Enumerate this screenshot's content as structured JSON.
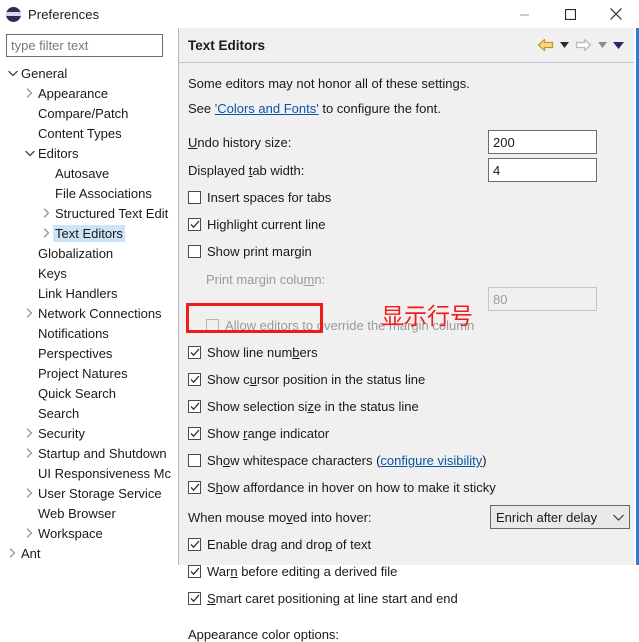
{
  "window": {
    "title": "Preferences",
    "icon": "eclipse-icon",
    "controls": {
      "minimize": "minimize-icon",
      "maximize": "maximize-icon",
      "close": "close-icon"
    }
  },
  "sidebar": {
    "filter": {
      "value": "",
      "placeholder": "type filter text"
    },
    "items": [
      {
        "label": "General",
        "indent": 0,
        "twisty": "expanded",
        "selected": false
      },
      {
        "label": "Appearance",
        "indent": 1,
        "twisty": "collapsed",
        "selected": false
      },
      {
        "label": "Compare/Patch",
        "indent": 1,
        "twisty": "none",
        "selected": false
      },
      {
        "label": "Content Types",
        "indent": 1,
        "twisty": "none",
        "selected": false
      },
      {
        "label": "Editors",
        "indent": 1,
        "twisty": "expanded",
        "selected": false
      },
      {
        "label": "Autosave",
        "indent": 2,
        "twisty": "none",
        "selected": false
      },
      {
        "label": "File Associations",
        "indent": 2,
        "twisty": "none",
        "selected": false
      },
      {
        "label": "Structured Text Edit",
        "indent": 2,
        "twisty": "collapsed",
        "selected": false
      },
      {
        "label": "Text Editors",
        "indent": 2,
        "twisty": "collapsed",
        "selected": true
      },
      {
        "label": "Globalization",
        "indent": 1,
        "twisty": "none",
        "selected": false
      },
      {
        "label": "Keys",
        "indent": 1,
        "twisty": "none",
        "selected": false
      },
      {
        "label": "Link Handlers",
        "indent": 1,
        "twisty": "none",
        "selected": false
      },
      {
        "label": "Network Connections",
        "indent": 1,
        "twisty": "collapsed",
        "selected": false
      },
      {
        "label": "Notifications",
        "indent": 1,
        "twisty": "none",
        "selected": false
      },
      {
        "label": "Perspectives",
        "indent": 1,
        "twisty": "none",
        "selected": false
      },
      {
        "label": "Project Natures",
        "indent": 1,
        "twisty": "none",
        "selected": false
      },
      {
        "label": "Quick Search",
        "indent": 1,
        "twisty": "none",
        "selected": false
      },
      {
        "label": "Search",
        "indent": 1,
        "twisty": "none",
        "selected": false
      },
      {
        "label": "Security",
        "indent": 1,
        "twisty": "collapsed",
        "selected": false
      },
      {
        "label": "Startup and Shutdown",
        "indent": 1,
        "twisty": "collapsed",
        "selected": false
      },
      {
        "label": "UI Responsiveness Mc",
        "indent": 1,
        "twisty": "none",
        "selected": false
      },
      {
        "label": "User Storage Service",
        "indent": 1,
        "twisty": "collapsed",
        "selected": false
      },
      {
        "label": "Web Browser",
        "indent": 1,
        "twisty": "none",
        "selected": false
      },
      {
        "label": "Workspace",
        "indent": 1,
        "twisty": "collapsed",
        "selected": false
      },
      {
        "label": "Ant",
        "indent": 0,
        "twisty": "collapsed",
        "selected": false
      }
    ]
  },
  "page": {
    "title": "Text Editors",
    "toolbar": [
      {
        "name": "back-button",
        "icon": "arrow-left-icon",
        "state": "enabled"
      },
      {
        "name": "back-dropdown",
        "icon": "caret-down-icon",
        "state": "enabled"
      },
      {
        "name": "forward-button",
        "icon": "arrow-right-icon",
        "state": "disabled"
      },
      {
        "name": "forward-dropdown",
        "icon": "caret-down-icon",
        "state": "disabled"
      },
      {
        "name": "view-menu-button",
        "icon": "caret-down-icon",
        "state": "enabled"
      }
    ],
    "notes": {
      "line1": "Some editors may not honor all of these settings.",
      "line2_pre": "See ",
      "line2_link": "'Colors and Fonts'",
      "line2_post": " to configure the font."
    },
    "fields": [
      {
        "label_pre": "",
        "label_mn": "U",
        "label_post": "ndo history size:",
        "value": "200",
        "disabled": false
      },
      {
        "label_pre": "Displayed ",
        "label_mn": "t",
        "label_post": "ab width:",
        "value": "4",
        "disabled": false
      },
      {
        "label_pre": "Print margin colu",
        "label_mn": "m",
        "label_post": "n:",
        "value": "80",
        "disabled": true
      }
    ],
    "checkboxes": [
      {
        "pre": "Insert spaces for tabs",
        "mn": "",
        "post": "",
        "checked": false,
        "disabled": false
      },
      {
        "pre": "Highlight current line",
        "mn": "",
        "post": "",
        "checked": true,
        "disabled": false
      },
      {
        "pre": "Show print margin",
        "mn": "",
        "post": "",
        "checked": false,
        "disabled": false
      },
      {
        "pre": "Allow editors to override the margin column",
        "mn": "",
        "post": "",
        "checked": false,
        "disabled": true
      },
      {
        "pre": "Show line num",
        "mn": "b",
        "post": "ers",
        "checked": true,
        "disabled": false
      },
      {
        "pre": "Show c",
        "mn": "u",
        "post": "rsor position in the status line",
        "checked": true,
        "disabled": false
      },
      {
        "pre": "Show selection si",
        "mn": "z",
        "post": "e in the status line",
        "checked": true,
        "disabled": false
      },
      {
        "pre": "Show ",
        "mn": "r",
        "post": "ange indicator",
        "checked": true,
        "disabled": false
      },
      {
        "pre": "Sh",
        "mn": "o",
        "post": "w whitespace characters (",
        "post_link": "configure visibility",
        "post2": ")",
        "checked": false,
        "disabled": false
      },
      {
        "pre": "S",
        "mn": "h",
        "post": "ow affordance in hover on how to make it sticky",
        "checked": true,
        "disabled": false
      },
      {
        "pre": "Enable drag and dro",
        "mn": "p",
        "post": " of text",
        "checked": true,
        "disabled": false
      },
      {
        "pre": "War",
        "mn": "n",
        "post": " before editing a derived file",
        "checked": true,
        "disabled": false
      },
      {
        "pre": "",
        "mn": "S",
        "post": "mart caret positioning at line start and end",
        "checked": true,
        "disabled": false
      }
    ],
    "hover": {
      "label_pre": "When mouse mo",
      "label_mn": "v",
      "label_post": "ed into hover:",
      "combo_value": "Enrich after delay",
      "combo_options": [
        "Enrich after delay"
      ]
    },
    "appearance_label": "Appearance color options:"
  },
  "annotations": {
    "highlight_box_target": "Show line numbers",
    "text": "显示行号",
    "color": "#ef1a1a"
  }
}
